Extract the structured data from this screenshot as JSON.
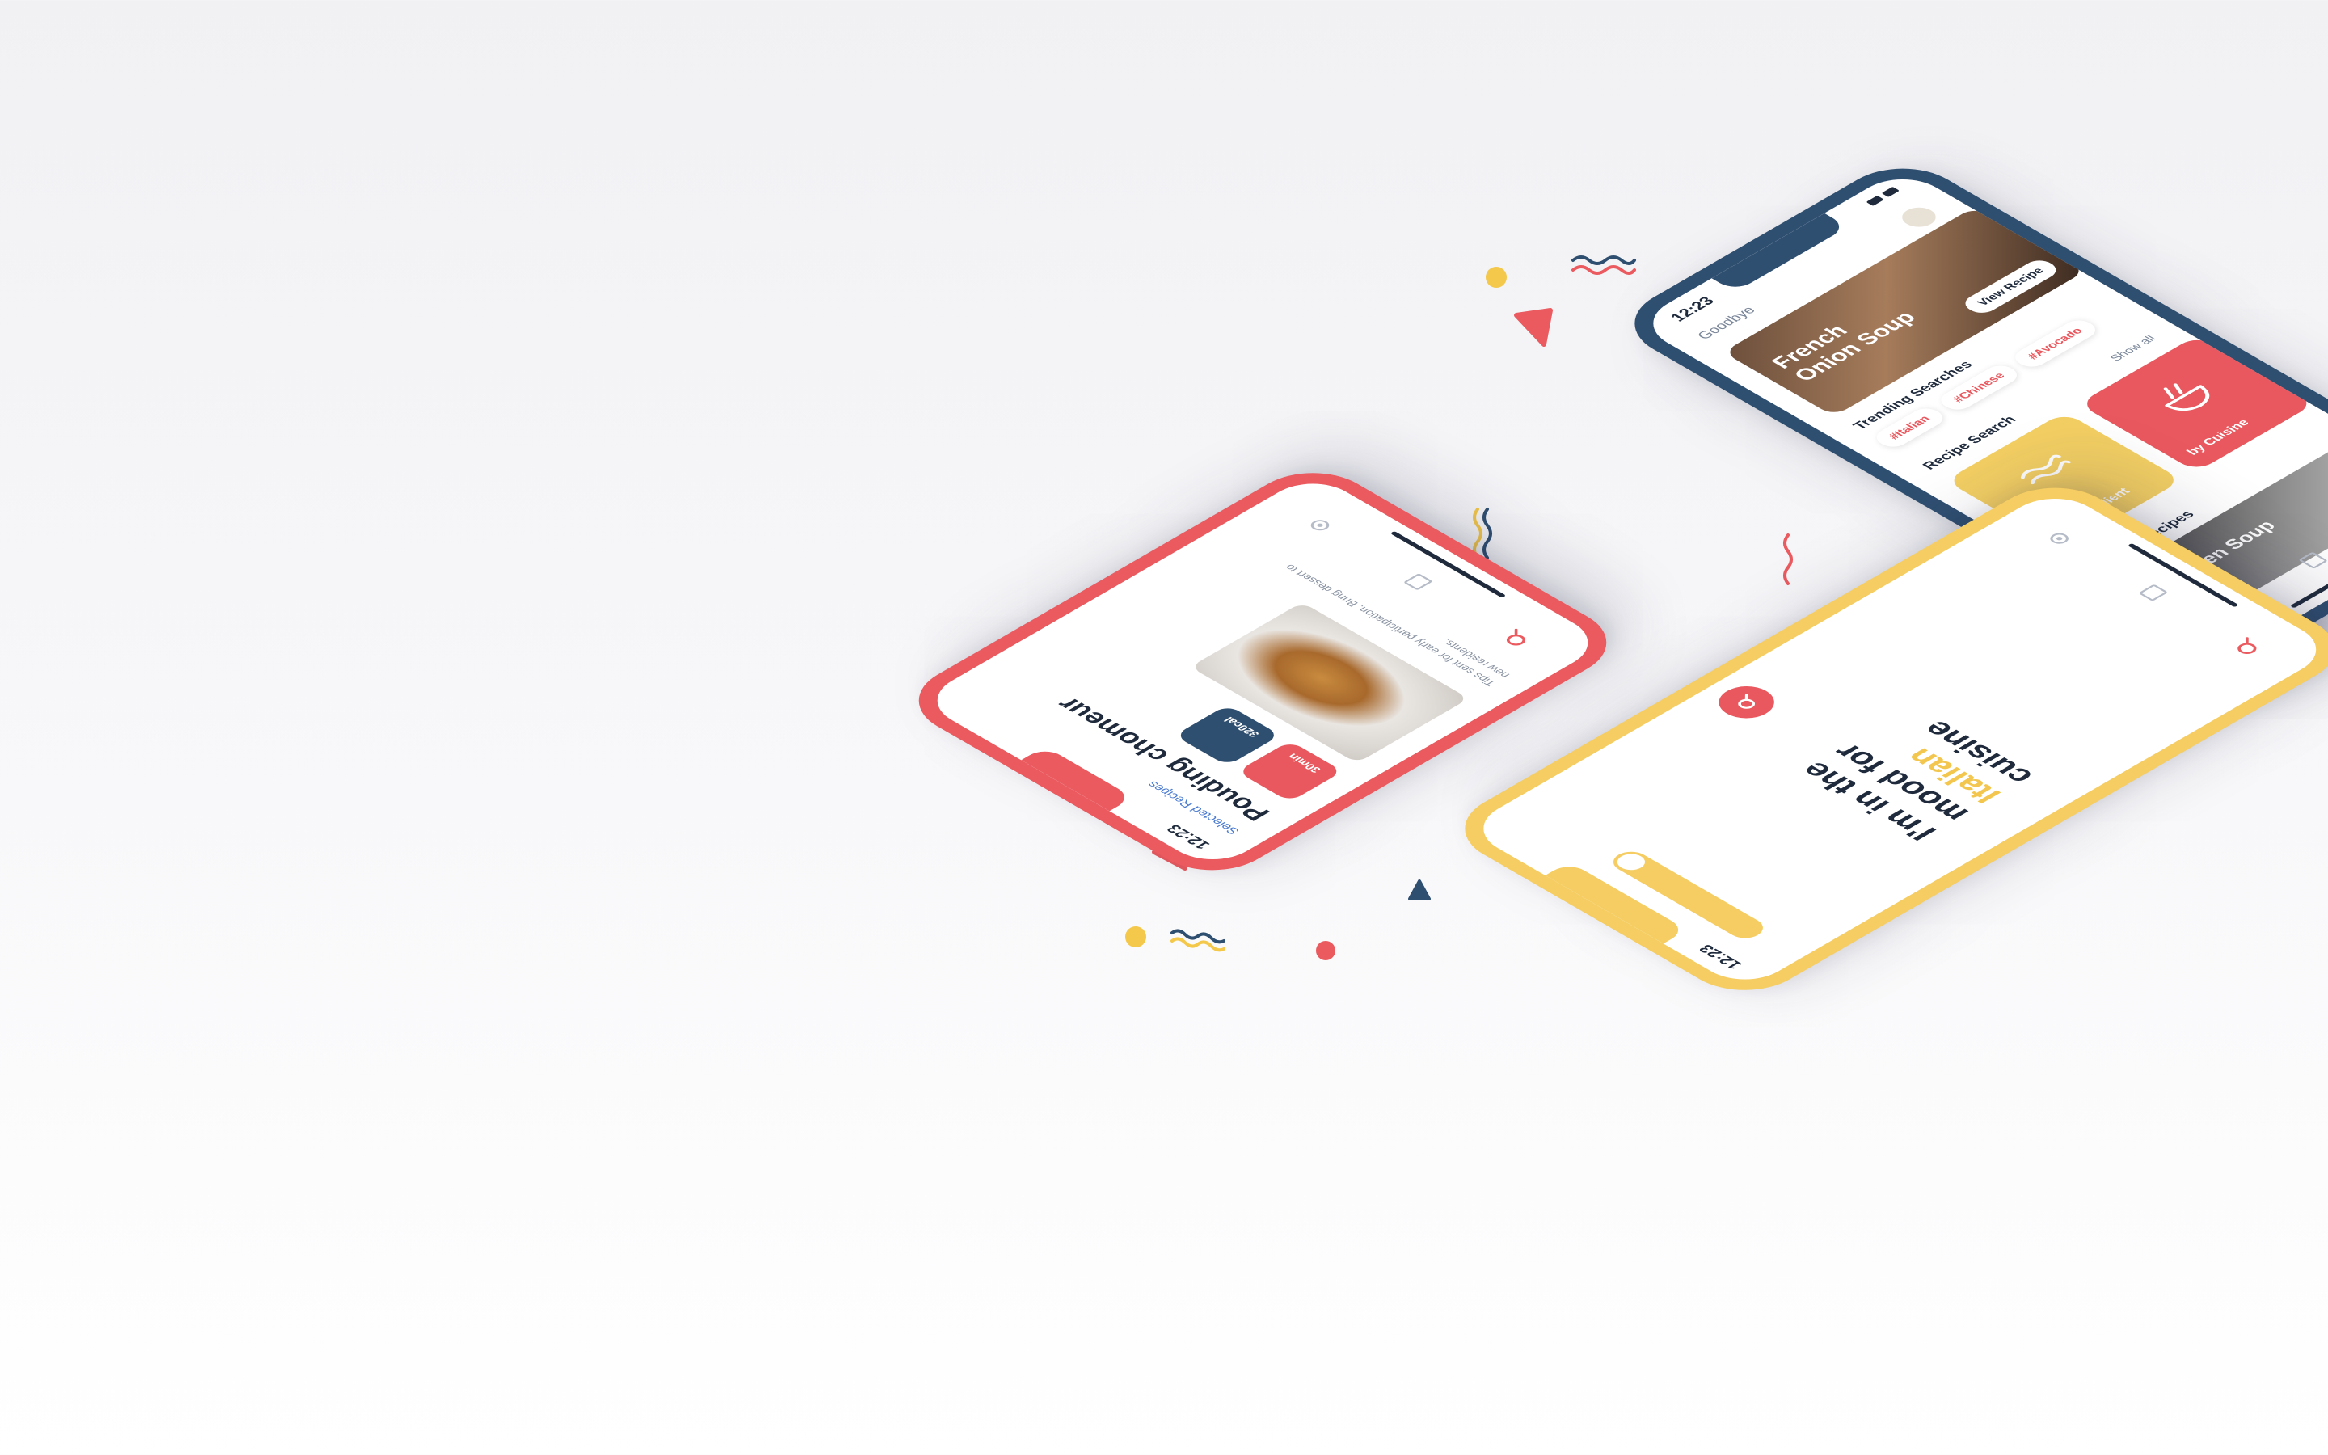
{
  "colors": {
    "blue": "#2f4f71",
    "red": "#ea5a5f",
    "yellow": "#f5cd62",
    "text_dark": "#1f2b3d",
    "text_muted": "#7a8699"
  },
  "home_screen": {
    "status_time": "12:23",
    "greeting": "Goodbye",
    "hero": {
      "title": "French Onion Soup",
      "button": "View Recipe"
    },
    "trending": {
      "label": "Trending Searches",
      "chips": [
        "#Italian",
        "#Chinese",
        "#Avocado"
      ]
    },
    "recipe_search": {
      "label": "Recipe Search",
      "show_all": "Show all",
      "tiles": [
        {
          "label": "by ingredient",
          "icon": "wave-icon"
        },
        {
          "label": "by Cuisine",
          "icon": "bowl-icon"
        }
      ]
    },
    "recent": {
      "label": "Recent Recipes",
      "card_title": "Chicken Soup"
    }
  },
  "recipe_screen": {
    "status_time": "12:23",
    "back_label": "Selected Recipes",
    "title": "Pouding chomeur",
    "badges": [
      {
        "label": "30min",
        "color": "red"
      },
      {
        "label": "320cal",
        "color": "blue"
      }
    ],
    "description": "Tips sent for early participation. Bring dessert to new residents."
  },
  "mood_screen": {
    "status_time": "12:23",
    "lines": [
      "I'm in the",
      "mood for"
    ],
    "highlight": "Italian",
    "last_line": "cuisine"
  }
}
